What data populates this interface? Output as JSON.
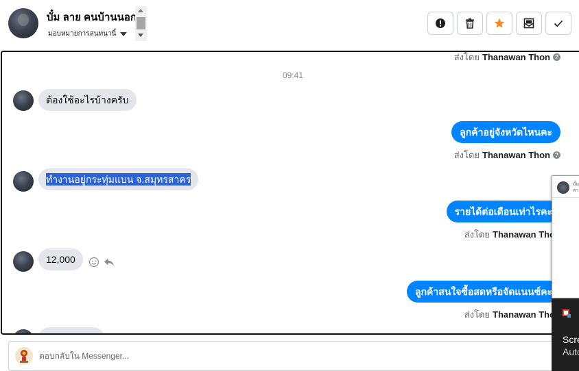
{
  "header": {
    "contact_name": "บั๋ม ลาย คนบ้านนอก",
    "assign_label": "มอบหมายการสนทนานี้",
    "actions": [
      {
        "label": "spam",
        "icon": "alert-circle-icon"
      },
      {
        "label": "delete",
        "icon": "trash-icon"
      },
      {
        "label": "star",
        "icon": "star-icon"
      },
      {
        "label": "mark-unread",
        "icon": "envelope-icon"
      },
      {
        "label": "done",
        "icon": "check-icon"
      }
    ],
    "accent_star": "#f5882a"
  },
  "chat": {
    "timestamp": "09:41",
    "sent_by_prefix": "ส่งโดย",
    "sender_name": "Thanawan Thon",
    "messages": [
      {
        "direction": "in",
        "text": "ต้องใช้อะไรบ้างครับ"
      },
      {
        "direction": "out",
        "text": "ลูกค้าอยู่จังหวัดไหนคะ"
      },
      {
        "direction": "in",
        "text": "ทำงานอยู่กระทุ่มแบน จ.สมุทรสาคร",
        "selected": true
      },
      {
        "direction": "out",
        "text": "รายได้ต่อเดือนเท่าไรคะ"
      },
      {
        "direction": "in",
        "text": "12,000"
      },
      {
        "direction": "out",
        "text": "ลูกค้าสนใจซื้อสดหรือจัดแนนซ์คะ"
      }
    ],
    "colors": {
      "outgoing": "#0084ff",
      "incoming": "#e4e6eb",
      "selection": "#2b63d6"
    }
  },
  "reply": {
    "placeholder": "ตอบกลับใน Messenger..."
  },
  "overlay": {
    "popup_text": "บั๋ม ลาย",
    "toast_line1": "Scre",
    "toast_line2": "Auto"
  }
}
